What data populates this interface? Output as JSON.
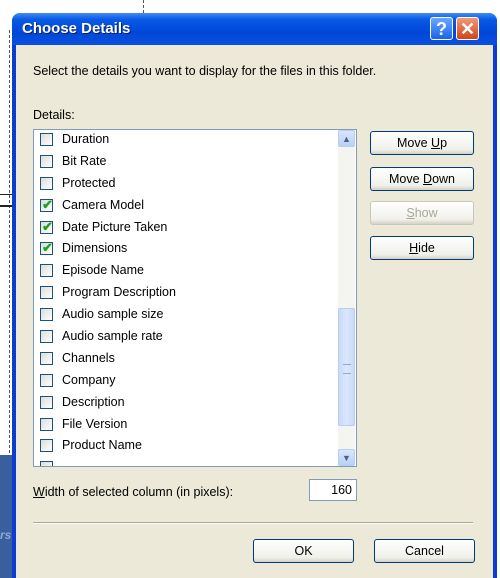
{
  "window": {
    "title": "Choose Details"
  },
  "titlebar": {
    "help_glyph": "?",
    "close_glyph": "✕"
  },
  "description": "Select the details you want to display for the files in this folder.",
  "details_label": "Details:",
  "details_items": [
    {
      "label": "Duration",
      "checked": false
    },
    {
      "label": "Bit Rate",
      "checked": false
    },
    {
      "label": "Protected",
      "checked": false
    },
    {
      "label": "Camera Model",
      "checked": true
    },
    {
      "label": "Date Picture Taken",
      "checked": true
    },
    {
      "label": "Dimensions",
      "checked": true
    },
    {
      "label": "Episode Name",
      "checked": false
    },
    {
      "label": "Program Description",
      "checked": false
    },
    {
      "label": "Audio sample size",
      "checked": false
    },
    {
      "label": "Audio sample rate",
      "checked": false
    },
    {
      "label": "Channels",
      "checked": false
    },
    {
      "label": "Company",
      "checked": false
    },
    {
      "label": "Description",
      "checked": false
    },
    {
      "label": "File Version",
      "checked": false
    },
    {
      "label": "Product Name",
      "checked": false
    }
  ],
  "buttons": {
    "move_up": {
      "pre": "Move ",
      "key": "U",
      "post": "p"
    },
    "move_down": {
      "pre": "Move ",
      "key": "D",
      "post": "own"
    },
    "show": {
      "pre": "",
      "key": "S",
      "post": "how"
    },
    "hide": {
      "pre": "",
      "key": "H",
      "post": "ide"
    },
    "ok": "OK",
    "cancel": "Cancel"
  },
  "width_field": {
    "label_key": "W",
    "label_rest": "idth of selected column (in pixels):",
    "value": "160"
  },
  "background": {
    "partial_text": "rs"
  },
  "icons": {
    "check": "✔",
    "scroll_up": "▲",
    "scroll_down": "▼"
  }
}
